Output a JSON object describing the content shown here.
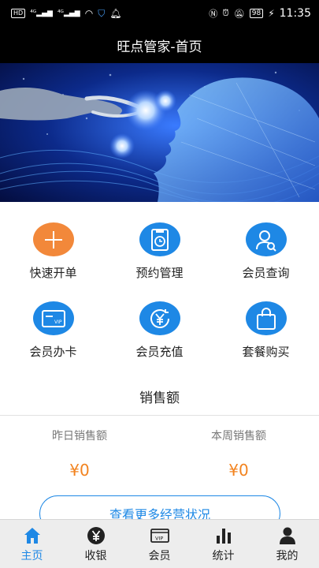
{
  "status_bar": {
    "left_chips": [
      "HD",
      "4G",
      "4G"
    ],
    "battery": "98",
    "time": "11:35"
  },
  "header": {
    "title": "旺点管家-首页"
  },
  "menu": [
    {
      "label": "快速开单",
      "icon": "plus-icon",
      "color": "#f2883a"
    },
    {
      "label": "预约管理",
      "icon": "clock-document-icon",
      "color": "#1e88e5"
    },
    {
      "label": "会员查询",
      "icon": "user-search-icon",
      "color": "#1e88e5"
    },
    {
      "label": "会员办卡",
      "icon": "vip-card-icon",
      "color": "#1e88e5"
    },
    {
      "label": "会员充值",
      "icon": "yen-recharge-icon",
      "color": "#1e88e5"
    },
    {
      "label": "套餐购买",
      "icon": "shopping-bag-icon",
      "color": "#1e88e5"
    }
  ],
  "sales": {
    "title": "销售额",
    "yesterday_label": "昨日销售额",
    "yesterday_value": "¥0",
    "week_label": "本周销售额",
    "week_value": "¥0",
    "more_label": "查看更多经营状况"
  },
  "tabs": [
    {
      "label": "主页",
      "icon": "home-icon",
      "active": true
    },
    {
      "label": "收银",
      "icon": "yen-circle-icon",
      "active": false
    },
    {
      "label": "会员",
      "icon": "vip-card-icon",
      "active": false
    },
    {
      "label": "统计",
      "icon": "bar-chart-icon",
      "active": false
    },
    {
      "label": "我的",
      "icon": "person-icon",
      "active": false
    }
  ],
  "colors": {
    "accent": "#1e88e5",
    "orange": "#f2831f",
    "header_bg": "#000000"
  }
}
